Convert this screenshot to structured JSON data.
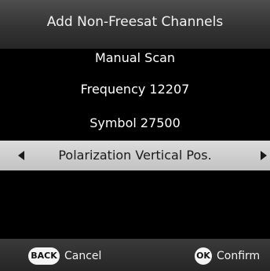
{
  "header": {
    "title": "Add Non-Freesat Channels"
  },
  "menu": {
    "items": [
      {
        "label": "Manual Scan"
      },
      {
        "label": "Frequency 12207"
      },
      {
        "label": "Symbol 27500"
      }
    ],
    "selected": {
      "label": "Polarization Vertical Pos.",
      "left_arrow": "◀",
      "right_arrow": "▶"
    }
  },
  "footer": {
    "back_key": "BACK",
    "cancel_label": "Cancel",
    "ok_key": "OK",
    "confirm_label": "Confirm"
  },
  "colors": {
    "background": "#000000",
    "selected_row": "#d0d0d0",
    "text": "#ffffff"
  }
}
